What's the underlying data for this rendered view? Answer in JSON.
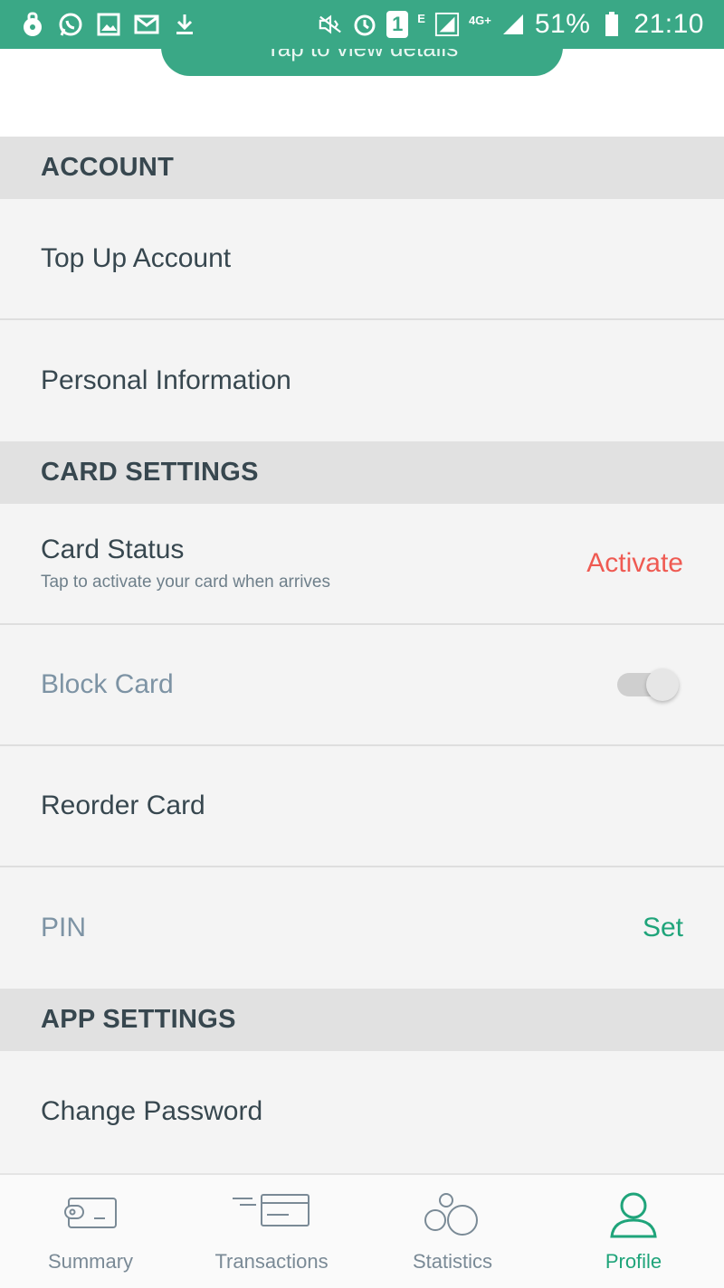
{
  "status_bar": {
    "battery": "51%",
    "time": "21:10",
    "network": "4G+",
    "sim": "1",
    "edge": "E",
    "icons": [
      "lock-icon",
      "whatsapp-icon",
      "gallery-icon",
      "mail-icon",
      "download-icon",
      "mute-icon",
      "alarm-icon",
      "signal-icon",
      "battery-icon"
    ]
  },
  "banner": {
    "text": "Tap to view details"
  },
  "sections": [
    {
      "header": "ACCOUNT",
      "rows": [
        {
          "title": "Top Up Account"
        },
        {
          "title": "Personal Information"
        }
      ]
    },
    {
      "header": "CARD SETTINGS",
      "rows": [
        {
          "title": "Card Status",
          "subtitle": "Tap to activate your card when arrives",
          "action": "Activate"
        },
        {
          "title": "Block Card",
          "toggle": false
        },
        {
          "title": "Reorder Card"
        },
        {
          "title": "PIN",
          "action": "Set"
        }
      ]
    },
    {
      "header": "APP SETTINGS",
      "rows": [
        {
          "title": "Change Password"
        }
      ]
    }
  ],
  "bottom_nav": {
    "items": [
      {
        "label": "Summary",
        "icon": "wallet-icon"
      },
      {
        "label": "Transactions",
        "icon": "card-transactions-icon"
      },
      {
        "label": "Statistics",
        "icon": "circles-icon"
      },
      {
        "label": "Profile",
        "icon": "user-icon",
        "active": true
      }
    ]
  },
  "colors": {
    "accent": "#3aa886",
    "active_green": "#1fa47a",
    "activate_red": "#ef5a52",
    "section_header_bg": "#e1e1e1"
  }
}
